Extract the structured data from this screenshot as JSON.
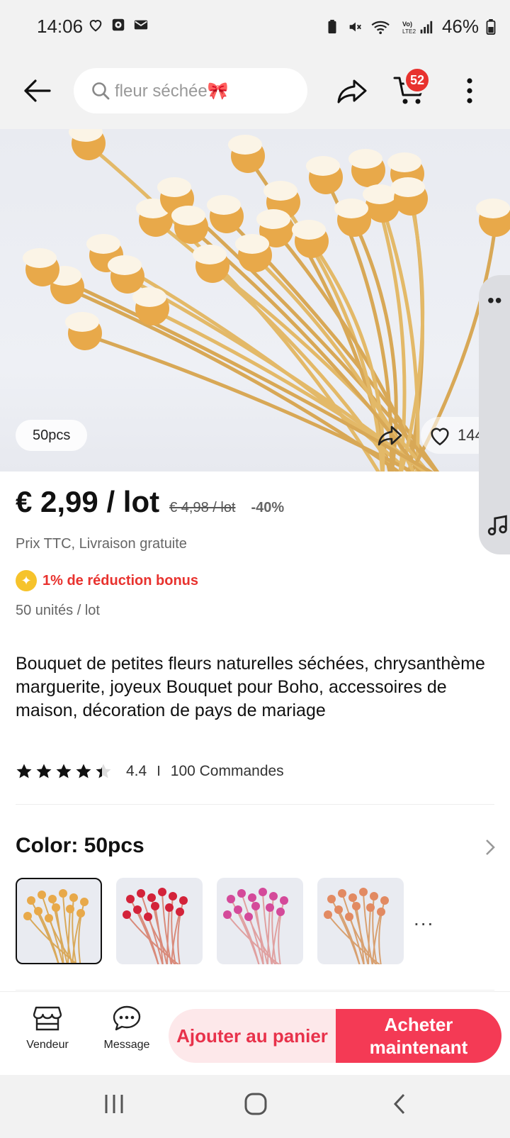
{
  "status_bar": {
    "time": "14:06",
    "battery": "46%"
  },
  "top_nav": {
    "search_placeholder": "fleur séchée🎀",
    "cart_count": "52"
  },
  "hero": {
    "variant_chip": "50pcs",
    "like_count": "144"
  },
  "price": {
    "current": "€ 2,99 / lot",
    "original": "€ 4,98 / lot",
    "discount": "-40%",
    "tax_info": "Prix TTC, Livraison gratuite",
    "bonus": "1% de réduction bonus",
    "units": "50 unités / lot"
  },
  "product": {
    "title": "Bouquet de petites fleurs naturelles séchées, chrysanthème marguerite, joyeux Bouquet pour Boho, accessoires de maison, décoration de pays de mariage",
    "rating": "4.4",
    "rating_stars": 4.4,
    "separator": "I",
    "orders": "100 Commandes"
  },
  "color": {
    "label": "Color: 50pcs",
    "more": "...",
    "options": [
      {
        "flower": "#e8a94a",
        "stem": "#d9a95a"
      },
      {
        "flower": "#d3233a",
        "stem": "#d98a7a"
      },
      {
        "flower": "#d44a9a",
        "stem": "#e0a0a0"
      },
      {
        "flower": "#e28a62",
        "stem": "#d8a070"
      }
    ]
  },
  "action_bar": {
    "vendor": "Vendeur",
    "message": "Message",
    "add_to_cart": "Ajouter au panier",
    "buy_now": "Acheter maintenant"
  },
  "colors": {
    "accent": "#f43a55",
    "badge": "#e8322e",
    "bonus": "#f6c32b"
  }
}
